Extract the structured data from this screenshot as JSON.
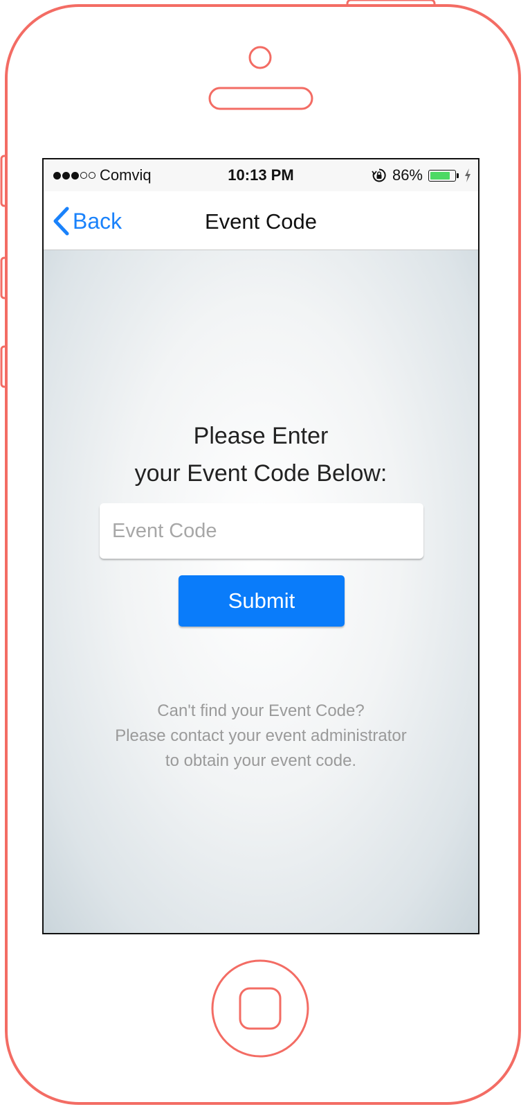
{
  "status_bar": {
    "carrier": "Comviq",
    "time": "10:13 PM",
    "battery_percent": "86%",
    "battery_level": 0.86,
    "signal_bars_filled": 3,
    "signal_bars_total": 5
  },
  "nav": {
    "back_label": "Back",
    "title": "Event Code"
  },
  "main": {
    "prompt_line1": "Please Enter",
    "prompt_line2": "your Event Code Below:",
    "input_placeholder": "Event Code",
    "input_value": "",
    "submit_label": "Submit",
    "help_line1": "Can't find your Event Code?",
    "help_line2": "Please contact your event administrator",
    "help_line3": "to obtain your event code."
  },
  "colors": {
    "accent": "#1a82fb",
    "button": "#0a7cfa",
    "device_outline": "#f36c64",
    "battery": "#4cd964"
  },
  "icons": [
    "chevron-left-icon",
    "rotation-lock-icon",
    "battery-icon",
    "charging-bolt-icon",
    "signal-dots-icon",
    "home-button-icon",
    "speaker-icon",
    "camera-icon"
  ]
}
